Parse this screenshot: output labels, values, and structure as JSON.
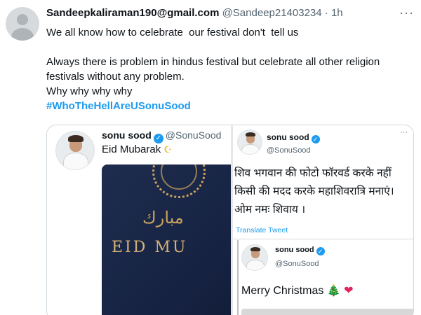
{
  "tweet": {
    "author_name": "Sandeepkaliraman190@gmail.com",
    "author_handle": "@Sandeep21403234",
    "separator": "·",
    "time": "1h",
    "more": "···",
    "text_line1": "We all know how to celebrate  our festival don't  tell us",
    "text_line2": "Always there is problem in hindus festival but celebrate all other religion festivals without any problem.",
    "text_line3": "Why why why why",
    "hashtag": "#WhoTheHellAreUSonuSood"
  },
  "embedded_left": {
    "name": "sonu sood",
    "handle": "@SonuSood",
    "text": "Eid Mubarak",
    "image_arabic": "مبارك",
    "image_text": "EID MU"
  },
  "embedded_right": {
    "name": "sonu sood",
    "handle": "@SonuSood",
    "more": "···",
    "hindi_line1": "शिव भगवान की फोटो फॉरवर्ड करके नहीं",
    "hindi_line2": "किसी की मदद करके महाशिवरात्रि मनाएं।",
    "hindi_line3": " ओम नमः शिवाय ।",
    "translate": "Translate Tweet",
    "inner_name": "sonu sood",
    "inner_handle": "@SonuSood",
    "inner_text": "Merry Christmas",
    "verified_icon": "✓",
    "tree_icon": "🎄",
    "heart_icon": "❤"
  },
  "colors": {
    "link": "#1d9bf0",
    "text": "#0f1419",
    "muted": "#536471",
    "image_bg": "#1e2c4e",
    "gold": "#c9a25c"
  }
}
